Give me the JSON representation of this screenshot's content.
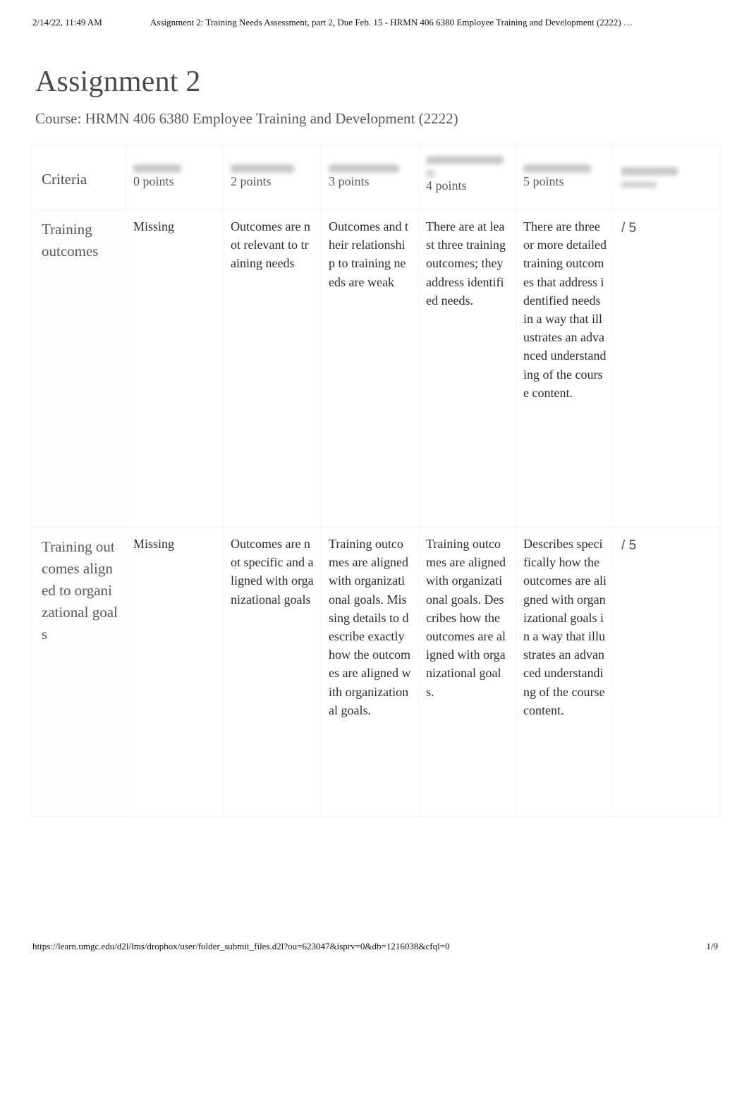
{
  "print_header": {
    "datetime": "2/14/22, 11:49 AM",
    "doc_title": "Assignment 2: Training Needs Assessment, part 2, Due Feb. 15 - HRMN 406 6380 Employee Training and Development (2222) …"
  },
  "page": {
    "title": "Assignment 2",
    "course": "Course: HRMN 406 6380 Employee Training and Development (2222)"
  },
  "rubric": {
    "criteria_header": "Criteria",
    "levels": [
      {
        "name_blurred": true,
        "points": "0 points"
      },
      {
        "name_blurred": true,
        "points": "2 points"
      },
      {
        "name_blurred": true,
        "points": "3 points"
      },
      {
        "name_blurred": true,
        "points": "4 points"
      },
      {
        "name_blurred": true,
        "points": "5 points"
      }
    ],
    "score_header_blurred": true,
    "rows": [
      {
        "criterion": "Training outcomes",
        "cells": [
          "Missing",
          "Outcomes are not relevant to training needs",
          "Outcomes and their relationship to training needs are weak",
          "There are at least three training outcomes; they address identified needs.",
          "There are three or more detailed training outcomes that address identified needs in a way that illustrates an advanced understanding of the course content."
        ],
        "score": "/ 5"
      },
      {
        "criterion": "Training outcomes aligned to organizational goals",
        "cells": [
          "Missing",
          "Outcomes are not specific and aligned with organizational goals",
          "Training outcomes are aligned with organizational goals. Missing details to describe exactly how the outcomes are aligned with organizational goals.",
          "Training outcomes are aligned with organizational goals. Describes how the outcomes are aligned with organizational goals.",
          "Describes specifically how the outcomes are aligned with organizational goals in a way that illustrates an advanced understanding of the course content."
        ],
        "score": "/ 5"
      }
    ]
  },
  "print_footer": {
    "url": "https://learn.umgc.edu/d2l/lms/dropbox/user/folder_submit_files.d2l?ou=623047&isprv=0&db=1216038&cfql=0",
    "page_indicator": "1/9"
  }
}
